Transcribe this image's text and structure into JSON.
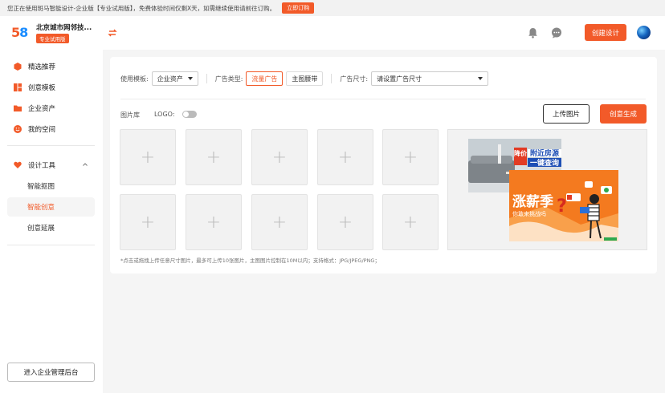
{
  "banner": {
    "text": "您正在使用斑马智能设计-企业版【专业试用版】，免费体验时间仅剩X天，如需继续使用请前往订购。",
    "buy_label": "立即订购"
  },
  "header": {
    "logo_text_a": "5",
    "logo_text_b": "8",
    "company_name": "北京城市网邻技...",
    "plan_badge": "专业试用版",
    "create_label": "创建设计",
    "icons": [
      "switch-icon",
      "bell-icon",
      "chat-icon"
    ]
  },
  "sidebar": {
    "items": [
      {
        "label": "精选推荐",
        "icon": "hexagon-icon"
      },
      {
        "label": "创意模板",
        "icon": "template-icon"
      },
      {
        "label": "企业资产",
        "icon": "folder-icon"
      },
      {
        "label": "我的空间",
        "icon": "smile-icon"
      }
    ],
    "tools": {
      "label": "设计工具",
      "icon": "heart-icon",
      "children": [
        {
          "label": "智能抠图",
          "active": false
        },
        {
          "label": "智能创意",
          "active": true
        },
        {
          "label": "创意延展",
          "active": false
        }
      ]
    },
    "enter_admin_label": "进入企业管理后台"
  },
  "panel": {
    "template_label": "使用模板:",
    "template_value": "企业资产",
    "ad_type_label": "广告类型:",
    "ad_types": [
      {
        "label": "流量广告",
        "active": true
      },
      {
        "label": "主图腰带",
        "active": false
      }
    ],
    "ad_size_label": "广告尺寸:",
    "ad_size_placeholder": "请设置广告尺寸",
    "library_label": "图片库",
    "logo_label": "LOGO:",
    "logo_enabled": false,
    "upload_label": "上传图片",
    "generate_label": "创意生成",
    "slot_symbol": "+",
    "note": "*点击或拖拽上传任意尺寸图片，最多可上传10张图片，主图图片控制在10M以内；支持格式：JPG/JPEG/PNG；",
    "preview": {
      "tag_left": "降价",
      "title_line1": "附近房源",
      "title_line2": "一键查询",
      "promo_main": "涨薪季",
      "promo_sub": "你敢来挑战吗"
    }
  },
  "colors": {
    "accent": "#f25a29",
    "blue": "#1a8cff"
  }
}
